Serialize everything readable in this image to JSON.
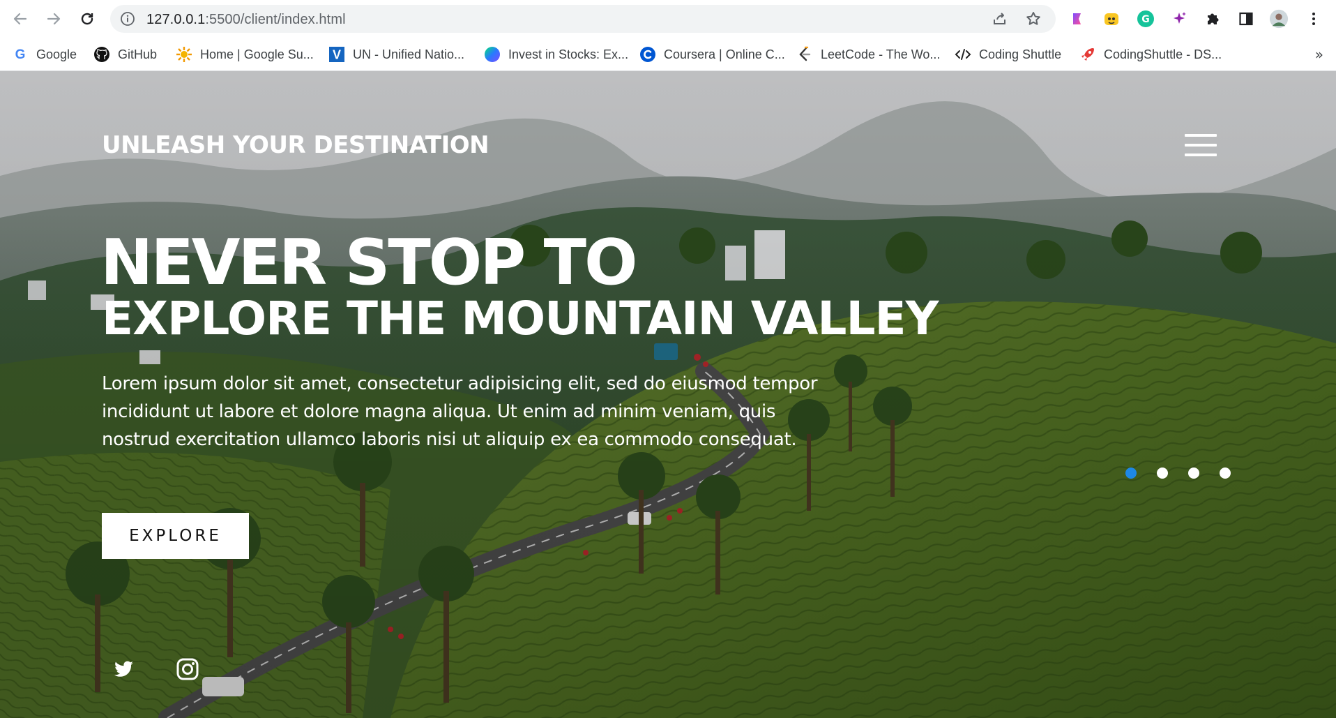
{
  "browser": {
    "url_host": "127.0.0.1",
    "url_path": ":5500/client/index.html",
    "bookmarks": [
      {
        "label": "Google",
        "icon": "google-icon"
      },
      {
        "label": "GitHub",
        "icon": "github-icon"
      },
      {
        "label": "Home | Google Su...",
        "icon": "sun-icon"
      },
      {
        "label": "UN - Unified Natio...",
        "icon": "v-letter-icon"
      },
      {
        "label": "Invest in Stocks: Ex...",
        "icon": "orb-icon"
      },
      {
        "label": "Coursera | Online C...",
        "icon": "coursera-icon"
      },
      {
        "label": "LeetCode - The Wo...",
        "icon": "leetcode-icon"
      },
      {
        "label": "Coding Shuttle",
        "icon": "code-brackets-icon"
      },
      {
        "label": "CodingShuttle - DS...",
        "icon": "rocket-icon"
      }
    ],
    "more": "»"
  },
  "page": {
    "brand": "UNLEASH YOUR DESTINATION",
    "headline_1": "NEVER STOP TO",
    "headline_2": "EXPLORE THE MOUNTAIN VALLEY",
    "lead": "Lorem ipsum dolor sit amet, consectetur adipisicing elit, sed do eiusmod tempor incididunt ut labore et dolore magna aliqua. Ut enim ad minim veniam, quis nostrud exercitation ullamco laboris nisi ut aliquip ex ea commodo consequat.",
    "cta": "EXPLORE",
    "slider": {
      "count": 4,
      "active_index": 0,
      "active_color": "#1e88e5"
    },
    "social": [
      "twitter-icon",
      "instagram-icon"
    ]
  }
}
